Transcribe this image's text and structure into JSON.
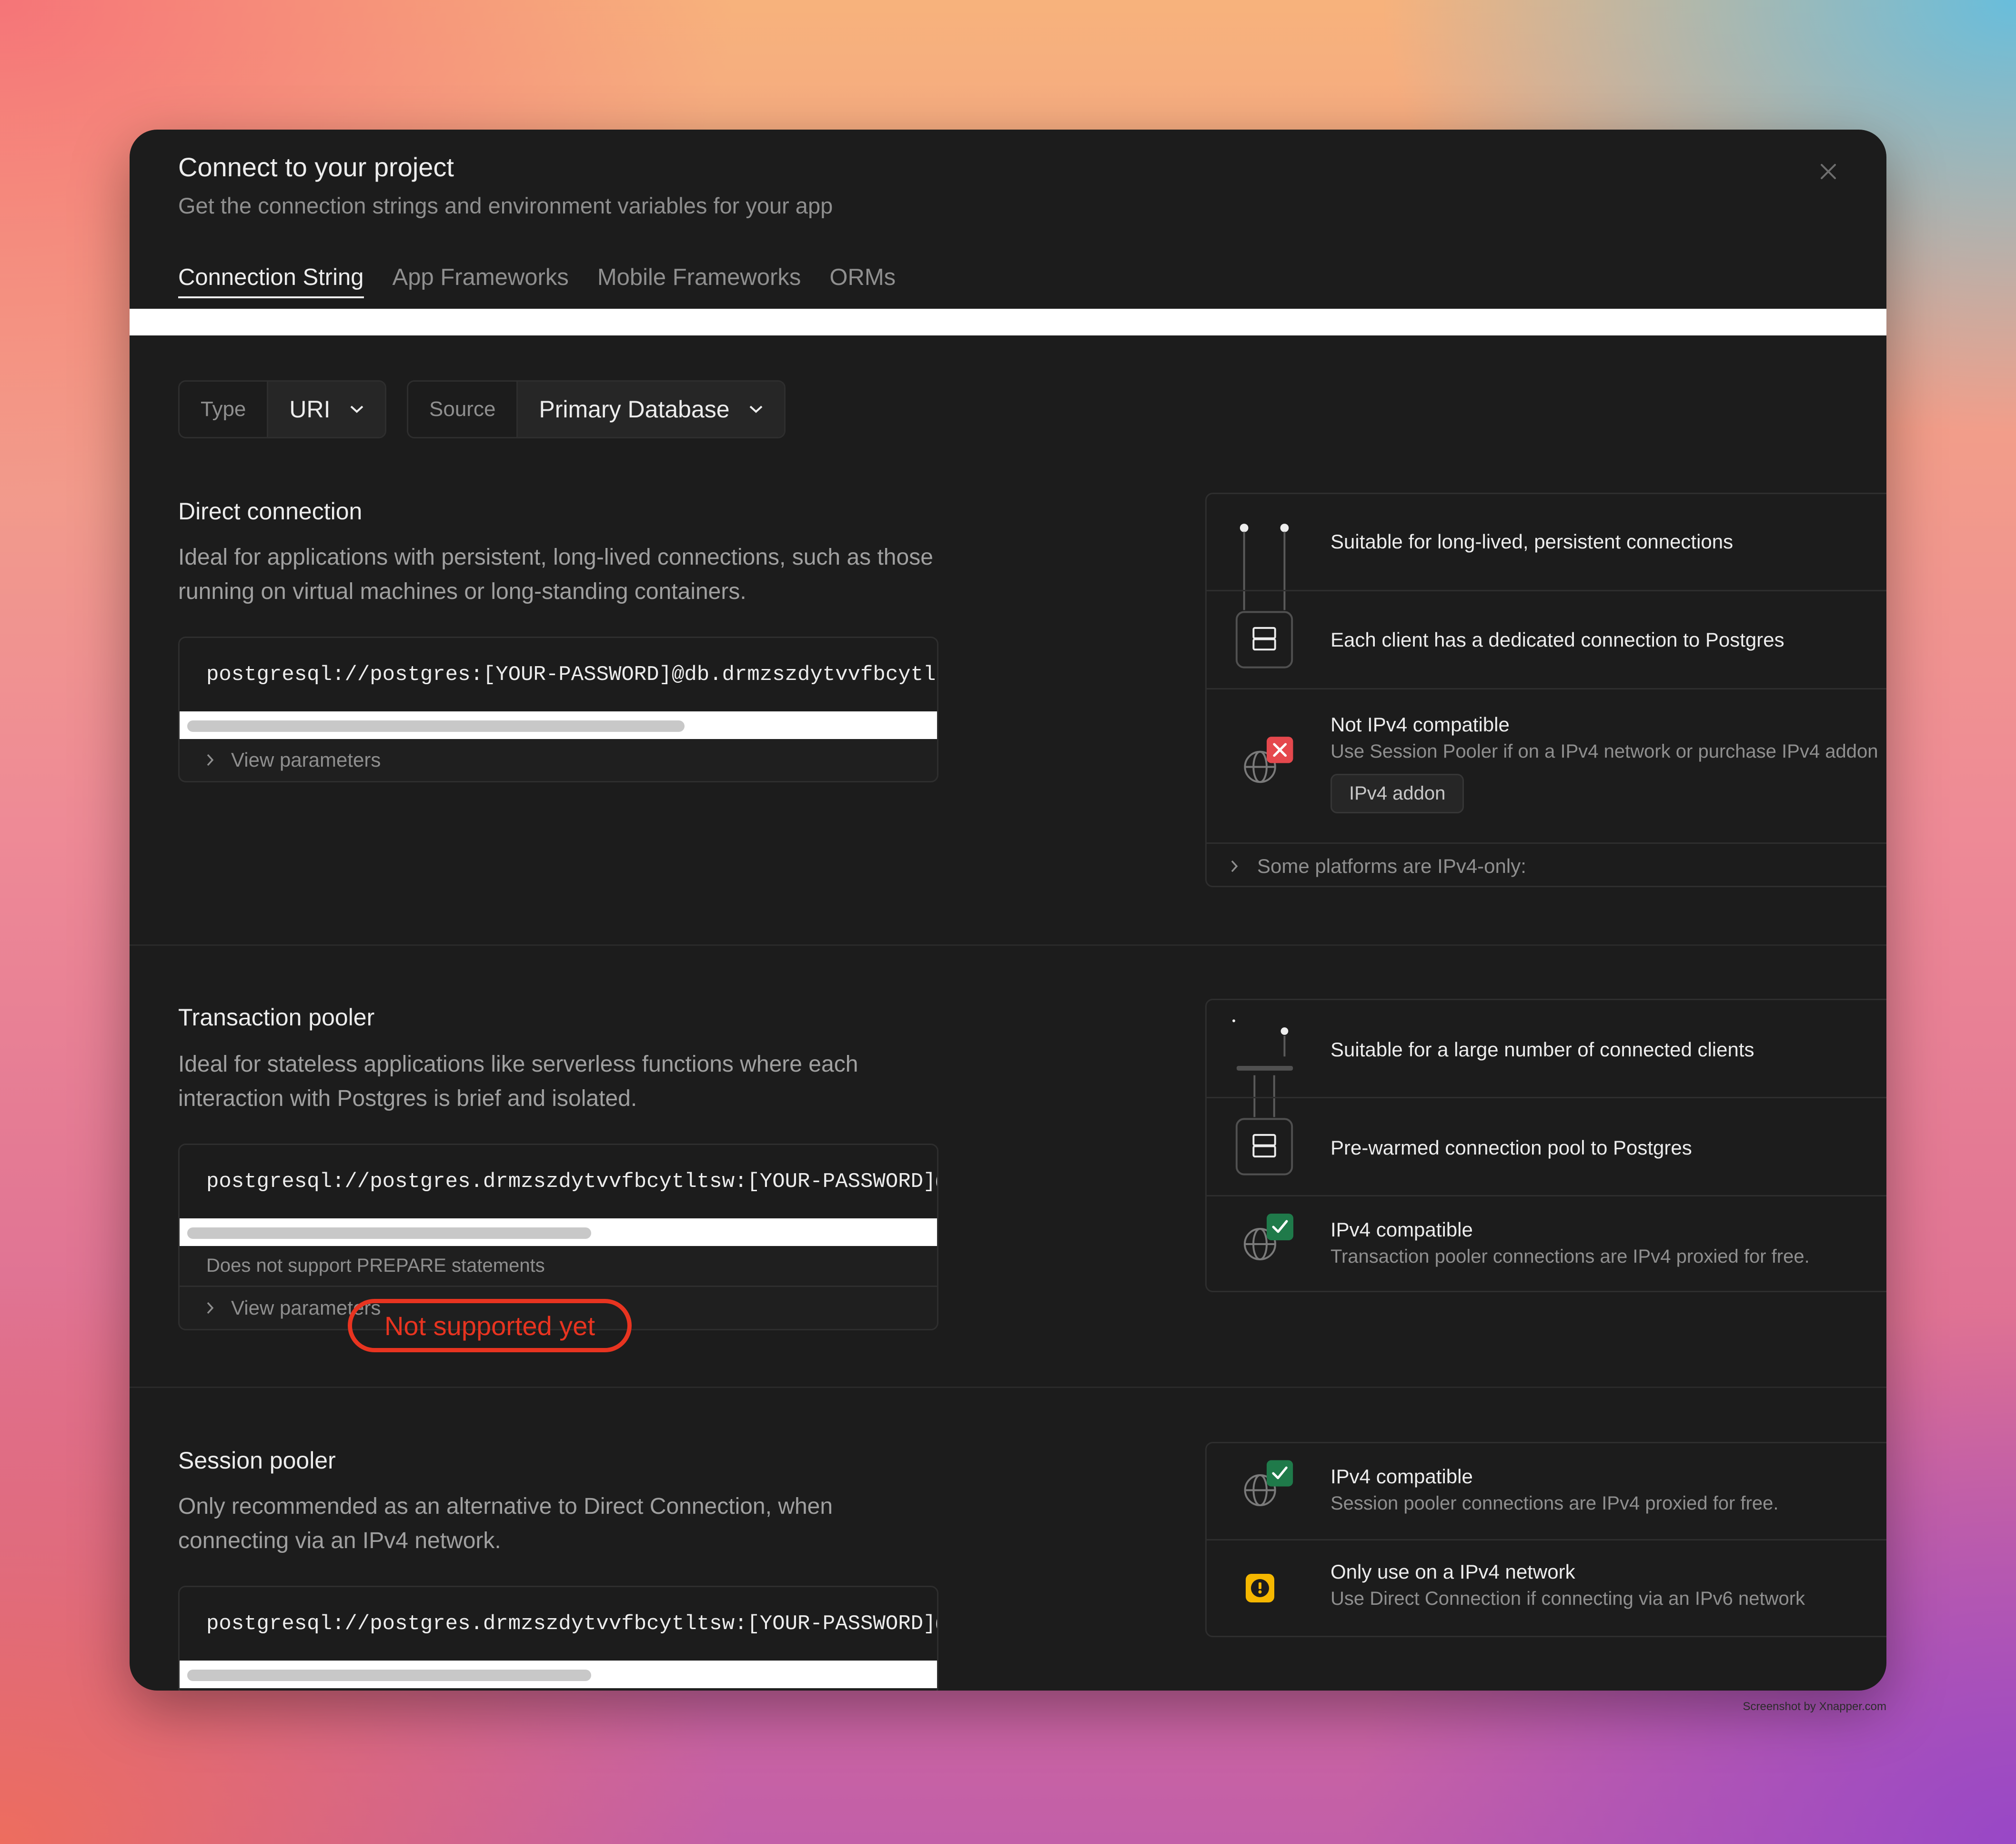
{
  "dialog": {
    "title": "Connect to your project",
    "subtitle": "Get the connection strings and environment variables for your app",
    "close_icon": "close-icon"
  },
  "tabs": [
    {
      "label": "Connection String",
      "active": true
    },
    {
      "label": "App Frameworks",
      "active": false
    },
    {
      "label": "Mobile Frameworks",
      "active": false
    },
    {
      "label": "ORMs",
      "active": false
    }
  ],
  "selectors": {
    "type": {
      "label": "Type",
      "value": "URI"
    },
    "source": {
      "label": "Source",
      "value": "Primary Database"
    }
  },
  "direct": {
    "title": "Direct connection",
    "description": "Ideal for applications with persistent, long-lived connections, such as those running on virtual machines or long-standing containers.",
    "connection_string": "postgresql://postgres:[YOUR-PASSWORD]@db.drmzszdytvvfbcytlts",
    "view_parameters": "View parameters",
    "info": {
      "row1": "Suitable for long-lived, persistent connections",
      "row2": "Each client has a dedicated connection to Postgres",
      "row3_title": "Not IPv4 compatible",
      "row3_sub": "Use Session Pooler if on a IPv4 network or purchase IPv4 addon",
      "addon_button": "IPv4 addon",
      "platforms": "Some platforms are IPv4-only:"
    }
  },
  "transaction": {
    "title": "Transaction pooler",
    "description": "Ideal for stateless applications like serverless functions where each interaction with Postgres is brief and isolated.",
    "connection_string": "postgresql://postgres.drmzszdytvvfbcytltsw:[YOUR-PASSWORD]@a",
    "note": "Does not support PREPARE statements",
    "view_parameters": "View parameters",
    "info": {
      "row1": "Suitable for a large number of connected clients",
      "row2": "Pre-warmed connection pool to Postgres",
      "row3_title": "IPv4 compatible",
      "row3_sub": "Transaction pooler connections are IPv4 proxied for free."
    }
  },
  "session": {
    "title": "Session pooler",
    "annotation": "Not supported yet",
    "description": "Only recommended as an alternative to Direct Connection, when connecting via an IPv4 network.",
    "connection_string": "postgresql://postgres.drmzszdytvvfbcytltsw:[YOUR-PASSWORD]@a",
    "info": {
      "row1_title": "IPv4 compatible",
      "row1_sub": "Session pooler connections are IPv4 proxied for free.",
      "row2_title": "Only use on a IPv4 network",
      "row2_sub": "Use Direct Connection if connecting via an IPv6 network"
    }
  },
  "watermark": "Screenshot by Xnapper.com",
  "colors": {
    "dialog_bg": "#1c1c1c",
    "error_badge": "#e5484d",
    "success_badge": "#1f7a4a",
    "warning_badge": "#f5b700",
    "annotation": "#e83420"
  }
}
